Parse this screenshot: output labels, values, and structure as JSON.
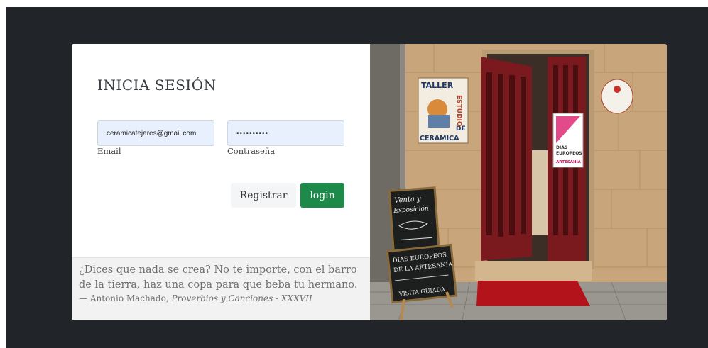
{
  "login": {
    "title": "INICIA SESIÓN",
    "email_value": "ceramicatejares@gmail.com",
    "password_value": "••••••••••",
    "email_label": "Email",
    "password_label": "Contraseña",
    "register_label": "Registrar",
    "login_label": "login"
  },
  "quote": {
    "text": "¿Dices que nada se crea? No te importe, con el barro de la tierra, haz una copa para que beba tu hermano.",
    "author": "— Antonio Machado, ",
    "source": "Proverbios y Canciones - XXXVII"
  },
  "photo": {
    "sign_top": "TALLER",
    "sign_vertical": "ESTUDIO",
    "sign_de": "DE",
    "sign_ceramica": "CERAMICA",
    "board1_line1": "Venta y",
    "board1_line2": "Exposición",
    "board2_line1": "DIAS EUROPEOS",
    "board2_line2": "DE LA ARTESANIA",
    "board2_line3": "VISITA GUIADA",
    "poster_line1": "DÍAS",
    "poster_line2": "EUROPEOS",
    "poster_line3": "ARTESANÍA"
  },
  "colors": {
    "backdrop": "#212428",
    "login_button": "#1e8a4a",
    "input_bg": "#e8f0fe",
    "quote_bg": "#f2f2f2",
    "door": "#7a1a1f",
    "carpet": "#b3141c"
  }
}
